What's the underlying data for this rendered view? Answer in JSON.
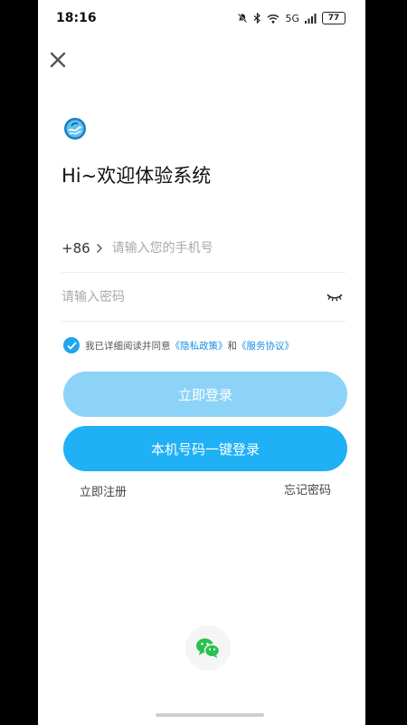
{
  "status_bar": {
    "time": "18:16",
    "network": "5G",
    "battery": "77",
    "icons": [
      "bell-muted-icon",
      "bluetooth-icon",
      "wifi-icon",
      "signal-icon",
      "battery-icon"
    ]
  },
  "header": {
    "close_icon": "close-icon"
  },
  "welcome": {
    "title": "Hi~欢迎体验系统"
  },
  "phone": {
    "country_code": "+86",
    "placeholder": "请输入您的手机号",
    "value": ""
  },
  "password": {
    "placeholder": "请输入密码",
    "value": "",
    "toggle_icon": "eye-closed-icon"
  },
  "agreement": {
    "checked": true,
    "prefix": "我已详细阅读并同意",
    "privacy_link": "《隐私政策》",
    "conjunction": "和",
    "service_link": "《服务协议》"
  },
  "buttons": {
    "login": "立即登录",
    "one_key_login": "本机号码一键登录"
  },
  "links": {
    "register": "立即注册",
    "forgot_password": "忘记密码"
  },
  "social": {
    "wechat_icon": "wechat-icon"
  },
  "colors": {
    "primary": "#1fb0f5",
    "primary_disabled": "#8dd3f7",
    "link": "#1a8fe0",
    "wechat": "#2ac14e"
  }
}
